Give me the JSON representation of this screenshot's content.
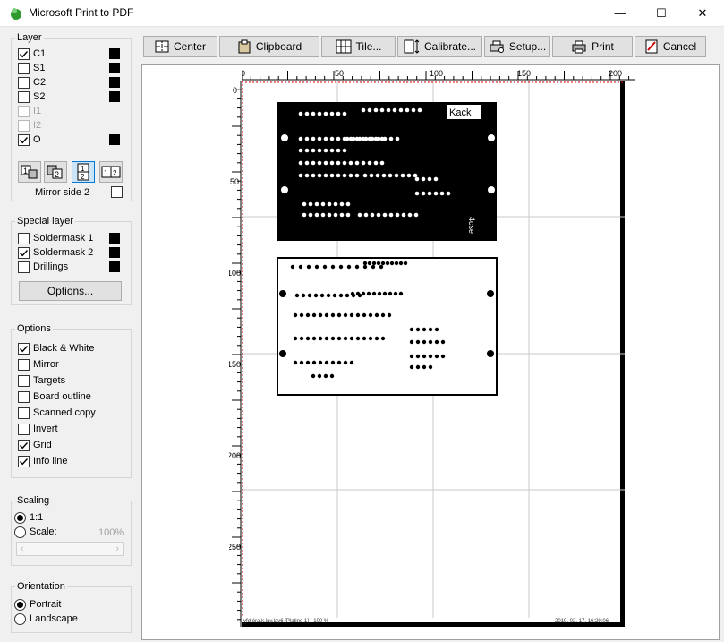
{
  "window": {
    "title": "Microsoft Print to PDF",
    "minimize": "—",
    "maximize": "☐",
    "close": "✕"
  },
  "toolbar": {
    "center": "Center",
    "clipboard": "Clipboard",
    "tile": "Tile...",
    "calibrate": "Calibrate...",
    "setup": "Setup...",
    "print": "Print",
    "cancel": "Cancel",
    "help": "?"
  },
  "layer": {
    "title": "Layer",
    "items": [
      {
        "label": "C1",
        "checked": true,
        "enabled": true
      },
      {
        "label": "S1",
        "checked": false,
        "enabled": true
      },
      {
        "label": "C2",
        "checked": false,
        "enabled": true
      },
      {
        "label": "S2",
        "checked": false,
        "enabled": true
      },
      {
        "label": "I1",
        "checked": false,
        "enabled": false
      },
      {
        "label": "I2",
        "checked": false,
        "enabled": false
      },
      {
        "label": "O",
        "checked": true,
        "enabled": true
      }
    ],
    "mirror_label": "Mirror side 2"
  },
  "special": {
    "title": "Special layer",
    "items": [
      {
        "label": "Soldermask 1",
        "checked": false
      },
      {
        "label": "Soldermask 2",
        "checked": true
      },
      {
        "label": "Drillings",
        "checked": false
      }
    ],
    "options_button": "Options..."
  },
  "options": {
    "title": "Options",
    "items": [
      {
        "label": "Black & White",
        "checked": true
      },
      {
        "label": "Mirror",
        "checked": false
      },
      {
        "label": "Targets",
        "checked": false
      },
      {
        "label": "Board outline",
        "checked": false
      },
      {
        "label": "Scanned copy",
        "checked": false
      },
      {
        "label": "Invert",
        "checked": false
      },
      {
        "label": "Grid",
        "checked": true
      },
      {
        "label": "Info line",
        "checked": true
      }
    ]
  },
  "scaling": {
    "title": "Scaling",
    "one_to_one": "1:1",
    "scale": "Scale:",
    "scale_value": "100%"
  },
  "orientation": {
    "title": "Orientation",
    "portrait": "Portrait",
    "landscape": "Landscape"
  },
  "preview": {
    "ruler_h": [
      "0",
      "50",
      "100",
      "150",
      "200"
    ],
    "ruler_v": [
      "0",
      "50",
      "100",
      "150",
      "200",
      "250"
    ],
    "info_left": "yfd óra.k.lay.lay6 [Platine 1] - 100 %",
    "info_right": "2019. 02. 17. 16:29:06",
    "board_text": "Kack",
    "board_text2": "4cse"
  },
  "colors": {
    "accent": "#0078d7",
    "board": "#000000"
  }
}
